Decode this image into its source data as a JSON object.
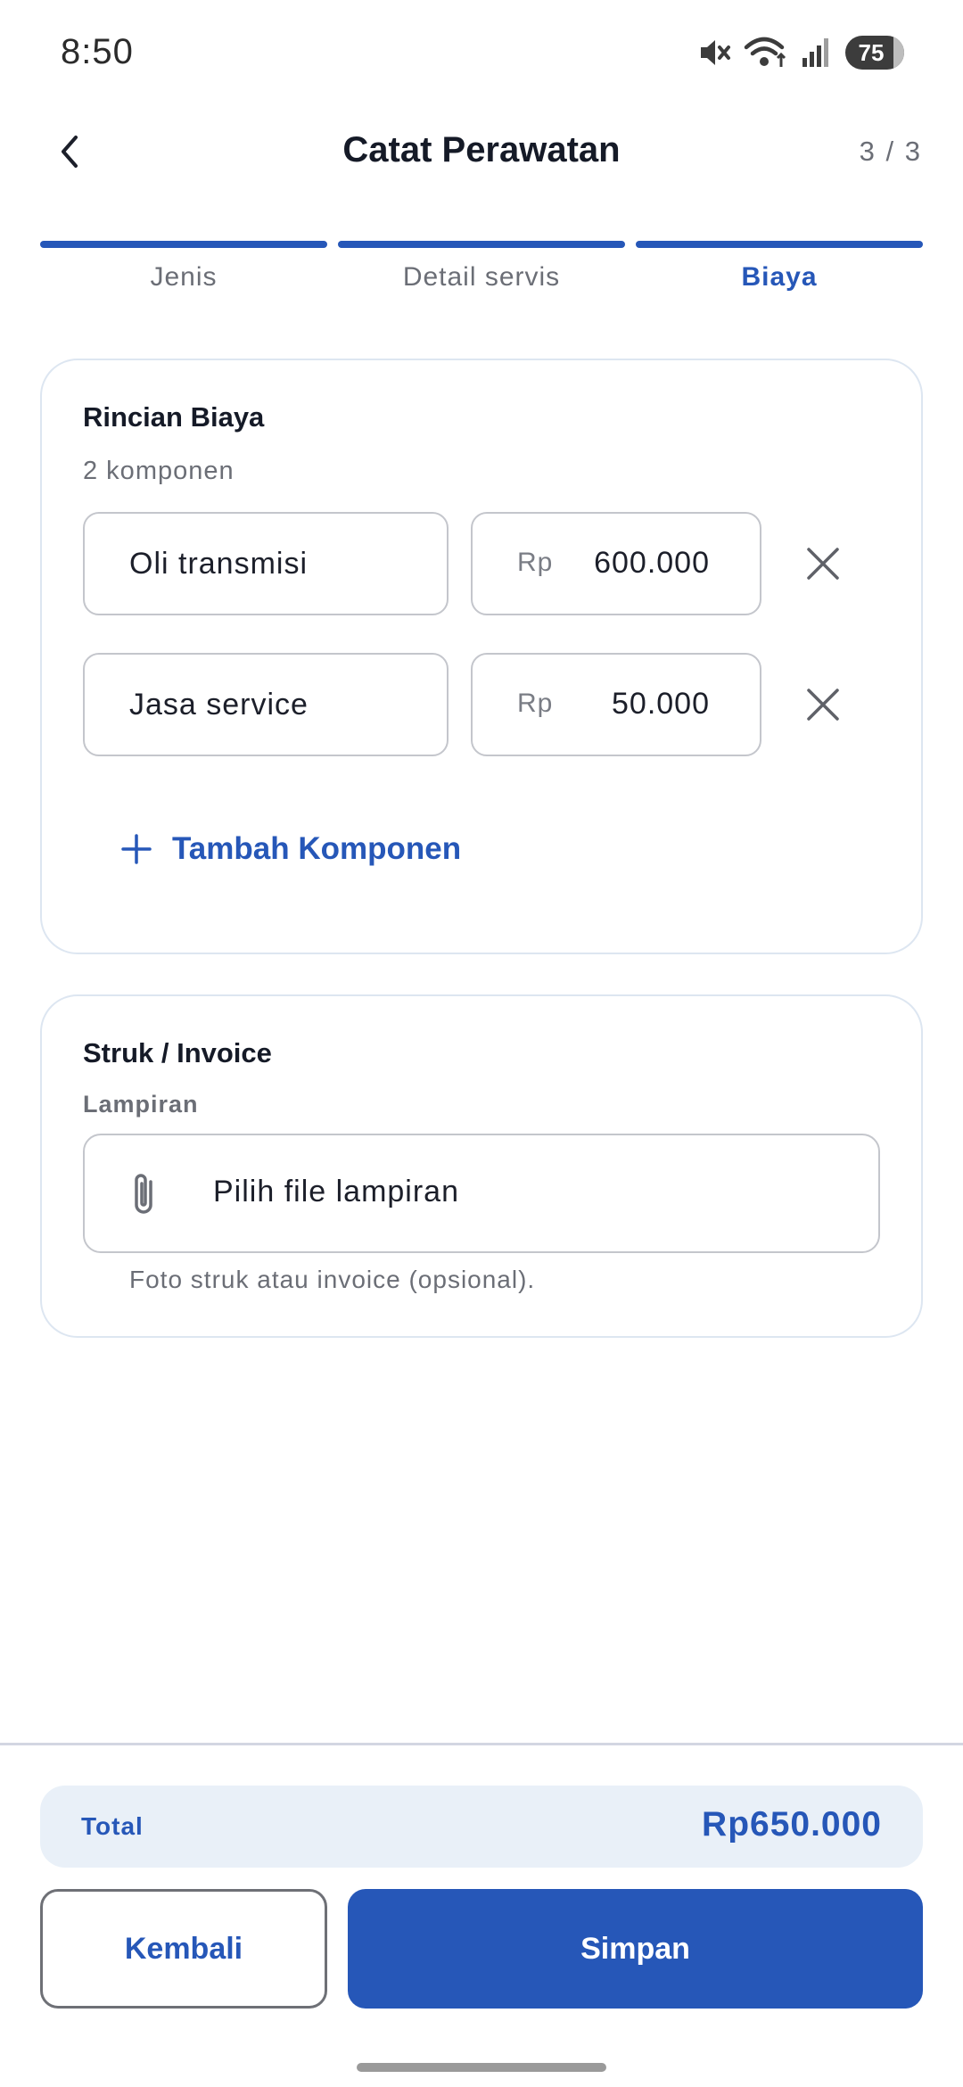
{
  "status_bar": {
    "time": "8:50",
    "battery": "75",
    "icons": [
      "mute-icon",
      "wifi-icon",
      "signal-icon",
      "battery-icon"
    ]
  },
  "app_bar": {
    "title": "Catat Perawatan",
    "step_counter": "3 / 3",
    "back_icon": "chevron-left-icon"
  },
  "stepper": {
    "steps": [
      {
        "label": "Jenis",
        "active": false
      },
      {
        "label": "Detail servis",
        "active": false
      },
      {
        "label": "Biaya",
        "active": true
      }
    ],
    "progress": 1.0
  },
  "cost_card": {
    "title": "Rincian Biaya",
    "subtitle": "2 komponen",
    "items": [
      {
        "name": "Oli transmisi",
        "currency": "Rp",
        "amount": "600.000"
      },
      {
        "name": "Jasa service",
        "currency": "Rp",
        "amount": "50.000"
      }
    ],
    "add_label": "Tambah Komponen"
  },
  "receipt_card": {
    "title": "Struk / Invoice",
    "field_label": "Lampiran",
    "attach_placeholder": "Pilih file lampiran",
    "helper": "Foto struk atau invoice (opsional)."
  },
  "footer": {
    "total_label": "Total",
    "total_value": "Rp650.000",
    "back_label": "Kembali",
    "save_label": "Simpan"
  },
  "colors": {
    "accent": "#2657b8",
    "card_border": "#dde6f1",
    "total_background": "#e9f0f8"
  }
}
